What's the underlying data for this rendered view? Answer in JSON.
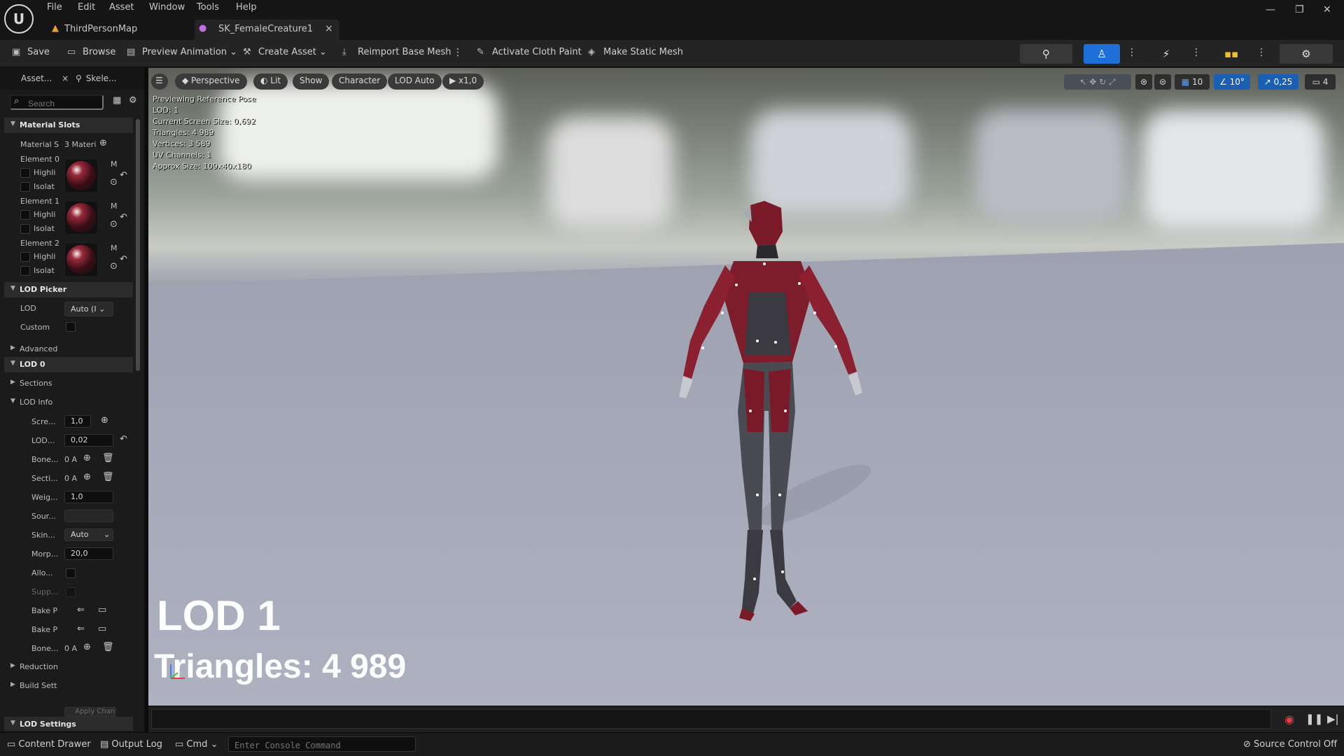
{
  "app": {
    "logo": "U"
  },
  "menu": [
    "File",
    "Edit",
    "Asset",
    "Window",
    "Tools",
    "Help"
  ],
  "tabs": [
    {
      "label": "ThirdPersonMap",
      "icon": "level-icon"
    },
    {
      "label": "SK_FemaleCreature1",
      "icon": "skeletal-mesh-icon",
      "close": "×"
    }
  ],
  "window_controls": {
    "minimize": "—",
    "restore": "❐",
    "close": "✕"
  },
  "toolbar": {
    "save": "Save",
    "browse": "Browse",
    "preview_animation": "Preview Animation",
    "create_asset": "Create Asset",
    "reimport": "Reimport Base Mesh",
    "cloth_paint": "Activate Cloth Paint",
    "static_mesh": "Make Static Mesh"
  },
  "left_panel": {
    "tabs": [
      {
        "label": "Asset...",
        "close": "×"
      },
      {
        "label": "Skele..."
      }
    ],
    "search_placeholder": "Search",
    "material_slots": {
      "header": "Material Slots",
      "slots_label": "Material S",
      "slots_value": "3 Materi",
      "elements": [
        {
          "label": "Element 0",
          "highlight": "Highli",
          "isolate": "Isolat",
          "m": "M"
        },
        {
          "label": "Element 1",
          "highlight": "Highli",
          "isolate": "Isolat",
          "m": "M"
        },
        {
          "label": "Element 2",
          "highlight": "Highli",
          "isolate": "Isolat",
          "m": "M"
        }
      ]
    },
    "lod_picker": {
      "header": "LOD Picker",
      "lod_label": "LOD",
      "lod_value": "Auto (I",
      "custom_label": "Custom",
      "advanced": "Advanced"
    },
    "lod0": {
      "header": "LOD 0",
      "sections": "Sections",
      "lod_info": "LOD Info",
      "rows": [
        {
          "label": "Scre...",
          "value": "1,0"
        },
        {
          "label": "LOD...",
          "value": "0,02"
        },
        {
          "label": "Bone...",
          "value": "0 A"
        },
        {
          "label": "Secti...",
          "value": "0 A"
        },
        {
          "label": "Weig...",
          "value": "1,0"
        },
        {
          "label": "Sour...",
          "value": ""
        },
        {
          "label": "Skin...",
          "value": "Auto"
        },
        {
          "label": "Morp...",
          "value": "20,0"
        },
        {
          "label": "Allo...",
          "value": ""
        },
        {
          "label": "Supp...",
          "value": ""
        },
        {
          "label": "Bake P",
          "value": ""
        },
        {
          "label": "Bake P",
          "value": ""
        },
        {
          "label": "Bone...",
          "value": "0 A"
        }
      ],
      "reduction": "Reduction",
      "build_settings": "Build Sett",
      "apply_changes": "Apply Chan"
    },
    "lod_settings": "LOD Settings"
  },
  "viewport": {
    "buttons": {
      "perspective": "Perspective",
      "lit": "Lit",
      "show": "Show",
      "character": "Character",
      "lod_auto": "LOD Auto",
      "speed": "x1,0"
    },
    "stats": [
      "Previewing Reference Pose",
      "LOD: 1",
      "Current Screen Size: 0,692",
      "Triangles: 4 989",
      "Vertices: 3 589",
      "UV Channels: 1",
      "Approx Size: 109x40x180"
    ],
    "right_tools": {
      "grid": "10",
      "angle": "10°",
      "scale": "0,25",
      "camera": "4"
    },
    "overlay_lod": "LOD 1",
    "overlay_triangles": "Triangles: 4 989"
  },
  "statusbar": {
    "content_drawer": "Content Drawer",
    "output_log": "Output Log",
    "cmd": "Cmd",
    "console_placeholder": "Enter Console Command",
    "source_control": "Source Control Off"
  },
  "colors": {
    "accent_blue": "#1f6fd8",
    "panel": "#1b1b1b",
    "toolbar": "#242424"
  }
}
